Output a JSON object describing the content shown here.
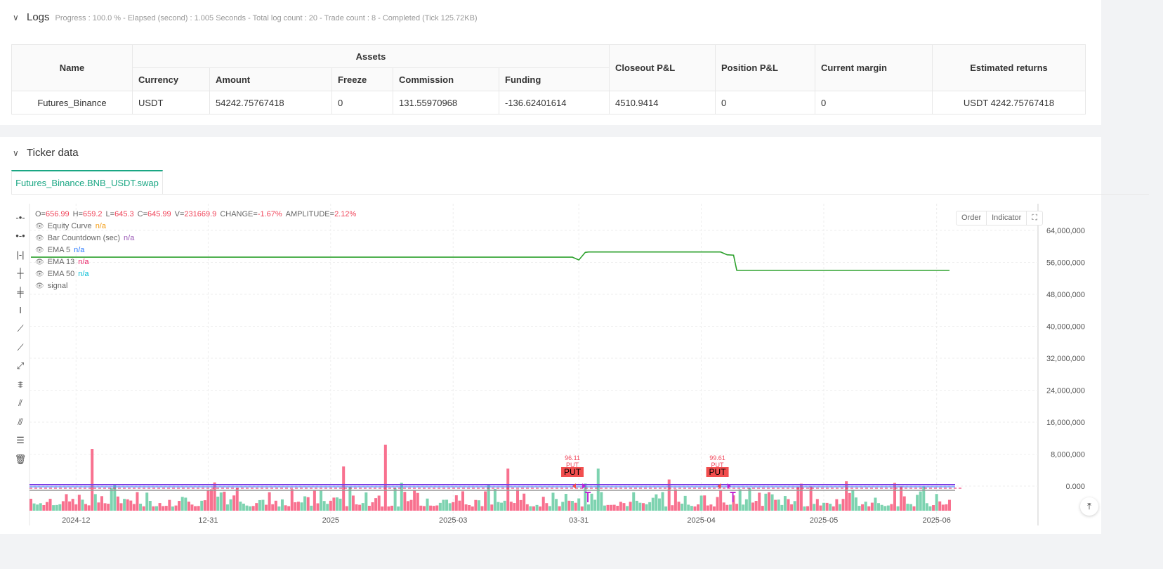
{
  "logs": {
    "title": "Logs",
    "summary": "Progress : 100.0 % - Elapsed (second) : 1.005  Seconds - Total log count : 20 - Trade count : 8 - Completed (Tick 125.72KB)"
  },
  "table": {
    "headers": {
      "name": "Name",
      "assets": "Assets",
      "currency": "Currency",
      "amount": "Amount",
      "freeze": "Freeze",
      "commission": "Commission",
      "funding": "Funding",
      "closeout": "Closeout P&L",
      "position": "Position P&L",
      "margin": "Current margin",
      "returns": "Estimated returns"
    },
    "row": {
      "name": "Futures_Binance",
      "currency": "USDT",
      "amount": "54242.75767418",
      "freeze": "0",
      "commission": "131.55970968",
      "funding": "-136.62401614",
      "closeout": "4510.9414",
      "position": "0",
      "margin": "0",
      "returns": "USDT 4242.75767418"
    }
  },
  "ticker": {
    "title": "Ticker data",
    "tab": "Futures_Binance.BNB_USDT.swap"
  },
  "ohlc": {
    "o_label": "O=",
    "o": "656.99",
    "h_label": "H=",
    "h": "659.2",
    "l_label": "L=",
    "l": "645.3",
    "c_label": "C=",
    "c": "645.99",
    "v_label": "V=",
    "v": "231669.9",
    "change_label": "CHANGE=",
    "change": "-1.67%",
    "amp_label": "AMPLITUDE=",
    "amp": "2.12%"
  },
  "legend": [
    {
      "name": "Equity Curve",
      "value": "n/a",
      "color": "#f39c12"
    },
    {
      "name": "Bar Countdown (sec)",
      "value": "n/a",
      "color": "#9b59b6"
    },
    {
      "name": "EMA 5",
      "value": "n/a",
      "color": "#2979ff"
    },
    {
      "name": "EMA 13",
      "value": "n/a",
      "color": "#e91e63"
    },
    {
      "name": "EMA 50",
      "value": "n/a",
      "color": "#00bcd4"
    },
    {
      "name": "signal",
      "value": "",
      "color": "#888"
    }
  ],
  "buttons": {
    "order": "Order",
    "indicator": "Indicator"
  },
  "chart_data": {
    "type": "line",
    "title": "Equity Curve",
    "ylim": [
      -4000000,
      68000000
    ],
    "yticks": [
      0,
      8000000,
      16000000,
      24000000,
      32000000,
      40000000,
      48000000,
      56000000,
      64000000
    ],
    "ytick_labels": [
      "0.000",
      "8,000,000",
      "16,000,000",
      "24,000,000",
      "32,000,000",
      "40,000,000",
      "48,000,000",
      "56,000,000",
      "64,000,000"
    ],
    "xticks": [
      {
        "label": "2024-12",
        "bar": 14
      },
      {
        "label": "12-31",
        "bar": 55
      },
      {
        "label": "2025",
        "bar": 93
      },
      {
        "label": "2025-03",
        "bar": 131
      },
      {
        "label": "03-31",
        "bar": 170
      },
      {
        "label": "2025-04",
        "bar": 208
      },
      {
        "label": "2025-05",
        "bar": 246
      },
      {
        "label": "2025-06",
        "bar": 281
      }
    ],
    "nbars": 286,
    "equity": [
      [
        0,
        57300000
      ],
      [
        168,
        57300000
      ],
      [
        170,
        56600000
      ],
      [
        172,
        58500000
      ],
      [
        173,
        58600000
      ],
      [
        214,
        58600000
      ],
      [
        216,
        57900000
      ],
      [
        218,
        57800000
      ],
      [
        219,
        54000000
      ],
      [
        285,
        54000000
      ]
    ],
    "signals": [
      {
        "bar": 168,
        "price": "96.11",
        "label": "PUT"
      },
      {
        "bar": 213,
        "price": "99.61",
        "label": "PUT"
      }
    ],
    "up_color": "#7dd3b0",
    "down_color": "#f8718f",
    "equity_color": "#2ca02c"
  }
}
